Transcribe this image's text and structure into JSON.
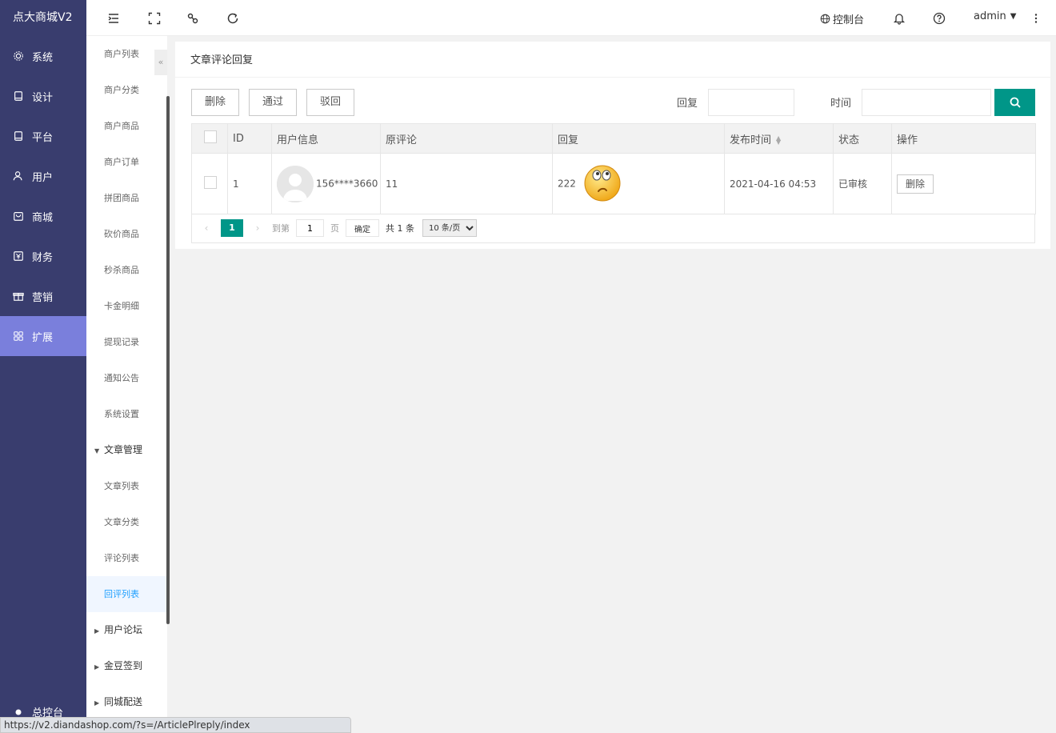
{
  "app": {
    "title": "点大商城V2"
  },
  "sidebar": {
    "items": [
      {
        "label": "系统",
        "icon": "gear-icon"
      },
      {
        "label": "设计",
        "icon": "tablet-icon"
      },
      {
        "label": "平台",
        "icon": "tablet-icon"
      },
      {
        "label": "用户",
        "icon": "user-icon"
      },
      {
        "label": "商城",
        "icon": "shop-icon"
      },
      {
        "label": "财务",
        "icon": "finance-icon"
      },
      {
        "label": "营销",
        "icon": "gift-icon"
      },
      {
        "label": "扩展",
        "icon": "grid-icon",
        "active": true
      }
    ],
    "bottom_label": "总控台"
  },
  "submenu": {
    "items": [
      "商户列表",
      "商户分类",
      "商户商品",
      "商户订单",
      "拼团商品",
      "砍价商品",
      "秒杀商品",
      "卡金明细",
      "提现记录",
      "通知公告",
      "系统设置"
    ],
    "group_article": "文章管理",
    "article_items": [
      "文章列表",
      "文章分类",
      "评论列表",
      "回评列表"
    ],
    "active_item": "回评列表",
    "groups_collapsed": [
      "用户论坛",
      "金豆签到",
      "同城配送"
    ],
    "collapse_icon": "«"
  },
  "topbar": {
    "console_label": "控制台",
    "user": "admin"
  },
  "page": {
    "title": "文章评论回复",
    "buttons": {
      "delete": "删除",
      "approve": "通过",
      "reject": "驳回"
    },
    "filters": {
      "reply_label": "回复",
      "reply_value": "",
      "time_label": "时间",
      "time_value": ""
    }
  },
  "table": {
    "columns": [
      "ID",
      "用户信息",
      "原评论",
      "回复",
      "发布时间",
      "状态",
      "操作"
    ],
    "rows": [
      {
        "id": "1",
        "user": "156****3660",
        "comment": "11",
        "reply": "222",
        "time": "2021-04-16 04:53",
        "status": "已审核",
        "action": "删除"
      }
    ]
  },
  "pager": {
    "current": "1",
    "goto_label": "到第",
    "goto_value": "1",
    "page_unit": "页",
    "confirm": "确定",
    "total": "共 1 条",
    "page_size": "10 条/页"
  },
  "browser_status": {
    "url": "https://v2.diandashop.com/?s=/ArticlePlreply/index"
  },
  "colors": {
    "sidebar": "#393d6e",
    "active": "#7a7fdc",
    "primary": "#009688",
    "status_ok": "#5fb878"
  }
}
